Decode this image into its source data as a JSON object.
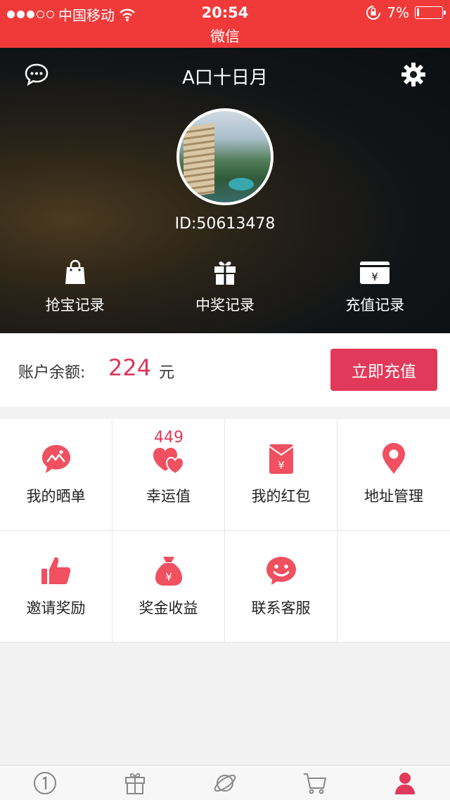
{
  "status_bar": {
    "carrier": "中国移动",
    "time": "20:54",
    "battery": "7%",
    "app_name": "微信"
  },
  "profile": {
    "title": "A口十日月",
    "user_id": "ID:50613478",
    "links": [
      {
        "label": "抢宝记录",
        "icon": "shopping-bag-icon"
      },
      {
        "label": "中奖记录",
        "icon": "gift-icon"
      },
      {
        "label": "充值记录",
        "icon": "yen-card-icon"
      }
    ]
  },
  "balance": {
    "label": "账户余额:",
    "value": "224",
    "unit": "元",
    "recharge_label": "立即充值"
  },
  "menu": [
    {
      "label": "我的晒单",
      "icon": "photo-bubble-icon",
      "badge": ""
    },
    {
      "label": "幸运值",
      "icon": "hearts-icon",
      "badge": "449"
    },
    {
      "label": "我的红包",
      "icon": "red-envelope-icon",
      "badge": ""
    },
    {
      "label": "地址管理",
      "icon": "location-pin-icon",
      "badge": ""
    },
    {
      "label": "邀请奖励",
      "icon": "thumbs-up-icon",
      "badge": ""
    },
    {
      "label": "奖金收益",
      "icon": "money-bag-icon",
      "badge": ""
    },
    {
      "label": "联系客服",
      "icon": "smiley-icon",
      "badge": ""
    }
  ],
  "colors": {
    "status_bar": "#f03a3a",
    "accent": "#e1395a",
    "icon": "#f0505f"
  },
  "tabs": [
    {
      "icon": "number-one-icon",
      "active": false
    },
    {
      "icon": "gift-icon",
      "active": false
    },
    {
      "icon": "planet-icon",
      "active": false
    },
    {
      "icon": "cart-icon",
      "active": false
    },
    {
      "icon": "user-icon",
      "active": true
    }
  ]
}
